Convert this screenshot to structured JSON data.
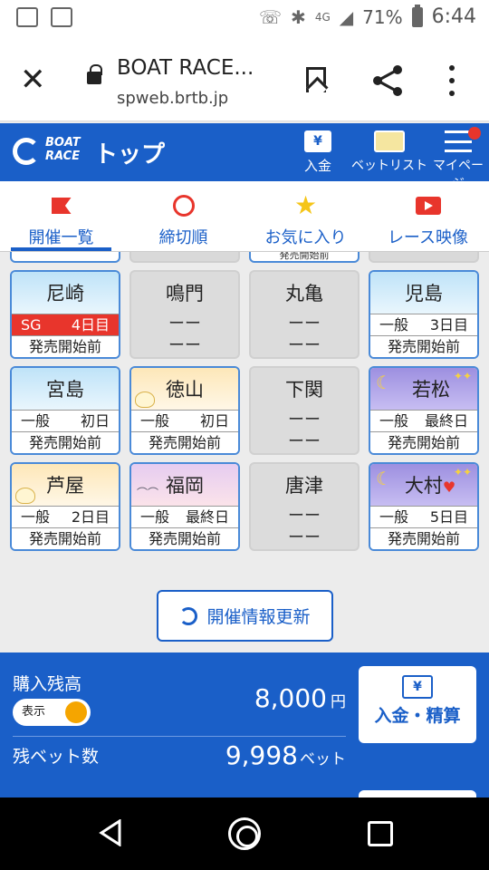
{
  "status_bar": {
    "battery_text": "71%",
    "time": "6:44",
    "network": "4G"
  },
  "browser": {
    "title": "BOAT RACE...",
    "url": "spweb.brtb.jp"
  },
  "app_header": {
    "logo_text": "BOAT RACE",
    "title": "トップ",
    "deposit_label": "入金",
    "deposit_icon_glyph": "¥",
    "betlist_label": "ベットリスト",
    "mypage_label": "マイページ"
  },
  "tabs": [
    {
      "label": "開催一覧",
      "icon": "flag-icon",
      "active": true
    },
    {
      "label": "締切順",
      "icon": "clock-icon",
      "active": false
    },
    {
      "label": "お気に入り",
      "icon": "star-icon",
      "active": false
    },
    {
      "label": "レース映像",
      "icon": "video-icon",
      "active": false
    }
  ],
  "top_stub_text": "発売開始前",
  "venues": [
    {
      "name": "尼崎",
      "open": true,
      "theme": "day",
      "grade": "SG",
      "day": "4日目",
      "status": "発売開始前",
      "sg": true
    },
    {
      "name": "鳴門",
      "open": false,
      "dash1": "ーー",
      "dash2": "ーー"
    },
    {
      "name": "丸亀",
      "open": false,
      "dash1": "ーー",
      "dash2": "ーー"
    },
    {
      "name": "児島",
      "open": true,
      "theme": "day",
      "grade": "一般",
      "day": "3日目",
      "status": "発売開始前"
    },
    {
      "name": "宮島",
      "open": true,
      "theme": "day",
      "grade": "一般",
      "day": "初日",
      "status": "発売開始前"
    },
    {
      "name": "徳山",
      "open": true,
      "theme": "morning",
      "grade": "一般",
      "day": "初日",
      "status": "発売開始前"
    },
    {
      "name": "下関",
      "open": false,
      "dash1": "ーー",
      "dash2": "ーー"
    },
    {
      "name": "若松",
      "open": true,
      "theme": "night",
      "grade": "一般",
      "day": "最終日",
      "status": "発売開始前"
    },
    {
      "name": "芦屋",
      "open": true,
      "theme": "morning",
      "grade": "一般",
      "day": "2日目",
      "status": "発売開始前"
    },
    {
      "name": "福岡",
      "open": true,
      "theme": "evening",
      "grade": "一般",
      "day": "最終日",
      "status": "発売開始前"
    },
    {
      "name": "唐津",
      "open": false,
      "dash1": "ーー",
      "dash2": "ーー"
    },
    {
      "name": "大村",
      "open": true,
      "theme": "night",
      "grade": "一般",
      "day": "5日目",
      "status": "発売開始前",
      "heart": true
    }
  ],
  "refresh_label": "開催情報更新",
  "balance": {
    "purchase_label": "購入残高",
    "toggle_label": "表示",
    "amount": "8,000",
    "amount_unit": "円",
    "bets_label": "残ベット数",
    "bets_amount": "9,998",
    "bets_unit": "ベット",
    "deposit_button_label": "入金・精算",
    "deposit_icon_glyph": "¥"
  },
  "colors": {
    "brand_blue": "#1a5fc8",
    "accent_red": "#e8352c",
    "toggle_orange": "#f5a500"
  }
}
